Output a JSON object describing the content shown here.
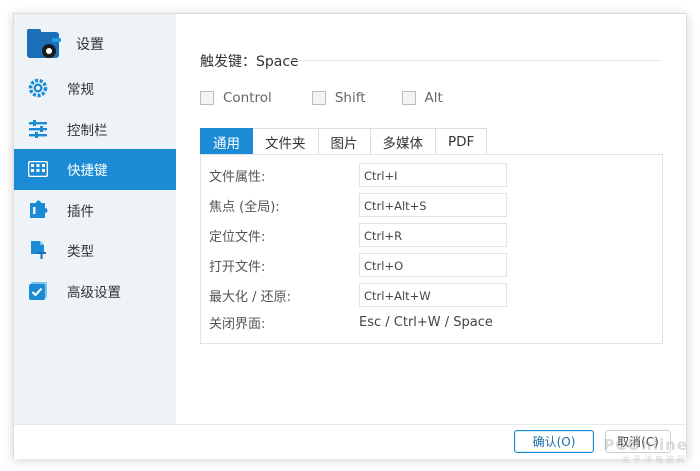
{
  "sidebar": {
    "title": "设置",
    "items": [
      {
        "label": "常规",
        "icon": "gear-icon"
      },
      {
        "label": "控制栏",
        "icon": "sliders-icon"
      },
      {
        "label": "快捷键",
        "icon": "keyboard-icon",
        "active": true
      },
      {
        "label": "插件",
        "icon": "puzzle-icon"
      },
      {
        "label": "类型",
        "icon": "file-type-icon"
      },
      {
        "label": "高级设置",
        "icon": "checkbox-icon"
      }
    ]
  },
  "hotkey": {
    "label": "触发键：Space",
    "modifiers": [
      "Control",
      "Shift",
      "Alt"
    ]
  },
  "tabs": [
    "通用",
    "文件夹",
    "图片",
    "多媒体",
    "PDF"
  ],
  "shortcuts": [
    {
      "label": "文件属性:",
      "value": "Ctrl+I"
    },
    {
      "label": "焦点 (全局):",
      "value": "Ctrl+Alt+S"
    },
    {
      "label": "定位文件:",
      "value": "Ctrl+R"
    },
    {
      "label": "打开文件:",
      "value": "Ctrl+O"
    },
    {
      "label": "最大化 / 还原:",
      "value": "Ctrl+Alt+W"
    },
    {
      "label": "关闭界面:",
      "value": "Esc / Ctrl+W / Space"
    }
  ],
  "footer": {
    "ok": "确认(O)",
    "cancel": "取消(C)"
  },
  "watermark": {
    "main": "PCOnline",
    "sub": "太平洋电脑网"
  },
  "colors": {
    "accent": "#1a8bd4",
    "sidebar_bg": "#eef3f8"
  }
}
